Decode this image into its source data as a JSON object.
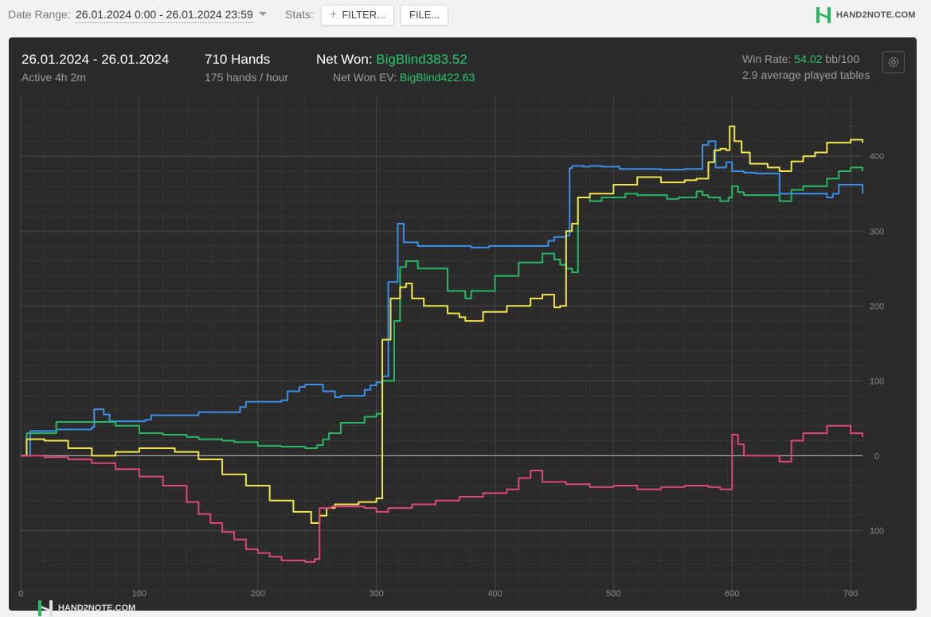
{
  "toolbar": {
    "date_range_label": "Date Range:",
    "date_range_value": "26.01.2024 0:00 - 26.01.2024 23:59",
    "stats_label": "Stats:",
    "filter_label": "FILTER...",
    "file_label": "FILE...",
    "brand": "HAND2NOTE.COM"
  },
  "summary": {
    "period": "26.01.2024 - 26.01.2024",
    "active": "Active 4h 2m",
    "hands": "710 Hands",
    "hands_rate": "175 hands / hour",
    "net_won_label": "Net Won:",
    "net_won_value": "BigBlind383.52",
    "net_won_ev_label": "Net Won  EV:",
    "net_won_ev_value": "BigBlind422.63",
    "win_rate_label": "Win Rate:",
    "win_rate_value": "54.02",
    "win_rate_unit": "bb/100",
    "tables": "2.9 average played tables"
  },
  "watermark": "HAND2NOTE.COM",
  "colors": {
    "panel": "#2b2b2b",
    "accent": "#27c46b"
  },
  "chart_data": {
    "type": "line",
    "xlim": [
      0,
      710
    ],
    "ylim": [
      -190,
      480
    ],
    "x_ticks": [
      0,
      100,
      200,
      300,
      400,
      500,
      600,
      700
    ],
    "y_ticks": [
      -100,
      0,
      100,
      200,
      300,
      400
    ],
    "y_tick_labels": [
      "100",
      "0",
      "100",
      "200",
      "300",
      "400"
    ],
    "grid": true,
    "series": [
      {
        "color": "#3b8ee8",
        "x": [
          0,
          5,
          8,
          30,
          60,
          62,
          70,
          75,
          105,
          110,
          150,
          185,
          190,
          220,
          225,
          235,
          240,
          255,
          265,
          270,
          290,
          295,
          300,
          305,
          310,
          318,
          323,
          335,
          350,
          380,
          385,
          395,
          420,
          445,
          450,
          460,
          463,
          465,
          475,
          480,
          490,
          505,
          520,
          540,
          560,
          575,
          580,
          586,
          595,
          600,
          610,
          620,
          640,
          680,
          685,
          690,
          710
        ],
        "y": [
          0,
          0,
          33,
          35,
          38,
          62,
          55,
          46,
          48,
          54,
          58,
          65,
          72,
          74,
          86,
          92,
          95,
          86,
          78,
          80,
          88,
          94,
          98,
          106,
          232,
          310,
          285,
          280,
          280,
          278,
          278,
          280,
          280,
          287,
          292,
          294,
          384,
          387,
          386,
          387,
          386,
          383,
          383,
          382,
          383,
          415,
          420,
          385,
          392,
          380,
          378,
          377,
          350,
          345,
          350,
          362,
          350
        ]
      },
      {
        "color": "#27b864",
        "x": [
          0,
          5,
          15,
          30,
          50,
          80,
          100,
          120,
          140,
          150,
          170,
          180,
          200,
          220,
          240,
          250,
          255,
          260,
          270,
          290,
          300,
          305,
          315,
          320,
          325,
          335,
          360,
          375,
          380,
          400,
          420,
          440,
          450,
          455,
          460,
          465,
          470,
          480,
          490,
          510,
          520,
          545,
          555,
          570,
          575,
          580,
          590,
          597,
          600,
          605,
          610,
          620,
          640,
          650,
          660,
          680,
          690,
          700,
          710
        ],
        "y": [
          0,
          30,
          30,
          45,
          45,
          40,
          30,
          28,
          25,
          22,
          20,
          18,
          13,
          12,
          10,
          14,
          22,
          30,
          44,
          52,
          56,
          100,
          180,
          252,
          260,
          250,
          220,
          210,
          220,
          240,
          258,
          270,
          262,
          255,
          250,
          245,
          345,
          340,
          345,
          350,
          348,
          343,
          345,
          353,
          348,
          345,
          340,
          345,
          360,
          352,
          348,
          348,
          340,
          355,
          360,
          370,
          380,
          385,
          380
        ]
      },
      {
        "color": "#f2e64a",
        "x": [
          0,
          5,
          20,
          40,
          60,
          80,
          100,
          130,
          150,
          170,
          190,
          210,
          230,
          245,
          252,
          258,
          265,
          285,
          300,
          305,
          312,
          320,
          325,
          330,
          340,
          360,
          370,
          375,
          390,
          410,
          430,
          440,
          450,
          455,
          460,
          465,
          470,
          480,
          500,
          520,
          540,
          560,
          570,
          580,
          585,
          590,
          595,
          598,
          602,
          608,
          615,
          630,
          640,
          650,
          660,
          670,
          680,
          700,
          710
        ],
        "y": [
          0,
          22,
          20,
          10,
          0,
          5,
          10,
          5,
          -5,
          -25,
          -40,
          -60,
          -75,
          -90,
          -80,
          -70,
          -65,
          -62,
          -57,
          155,
          210,
          225,
          230,
          210,
          200,
          190,
          185,
          180,
          192,
          200,
          210,
          215,
          198,
          200,
          300,
          310,
          345,
          350,
          362,
          372,
          365,
          368,
          370,
          392,
          408,
          410,
          408,
          440,
          420,
          405,
          390,
          385,
          380,
          393,
          400,
          405,
          418,
          422,
          418
        ]
      },
      {
        "color": "#e0457a",
        "x": [
          0,
          20,
          40,
          60,
          80,
          100,
          120,
          140,
          150,
          160,
          170,
          180,
          190,
          200,
          210,
          220,
          240,
          248,
          252,
          262,
          270,
          290,
          300,
          310,
          330,
          350,
          370,
          390,
          410,
          420,
          430,
          440,
          460,
          480,
          500,
          520,
          540,
          560,
          580,
          590,
          600,
          605,
          610,
          620,
          640,
          650,
          660,
          680,
          700,
          710
        ],
        "y": [
          0,
          -2,
          -5,
          -10,
          -18,
          -28,
          -40,
          -62,
          -78,
          -90,
          -102,
          -112,
          -125,
          -130,
          -135,
          -140,
          -142,
          -138,
          -70,
          -68,
          -68,
          -70,
          -75,
          -70,
          -65,
          -60,
          -55,
          -50,
          -45,
          -30,
          -20,
          -35,
          -38,
          -42,
          -40,
          -45,
          -42,
          -40,
          -42,
          -45,
          28,
          15,
          0,
          0,
          -8,
          20,
          30,
          40,
          30,
          25
        ]
      }
    ]
  }
}
